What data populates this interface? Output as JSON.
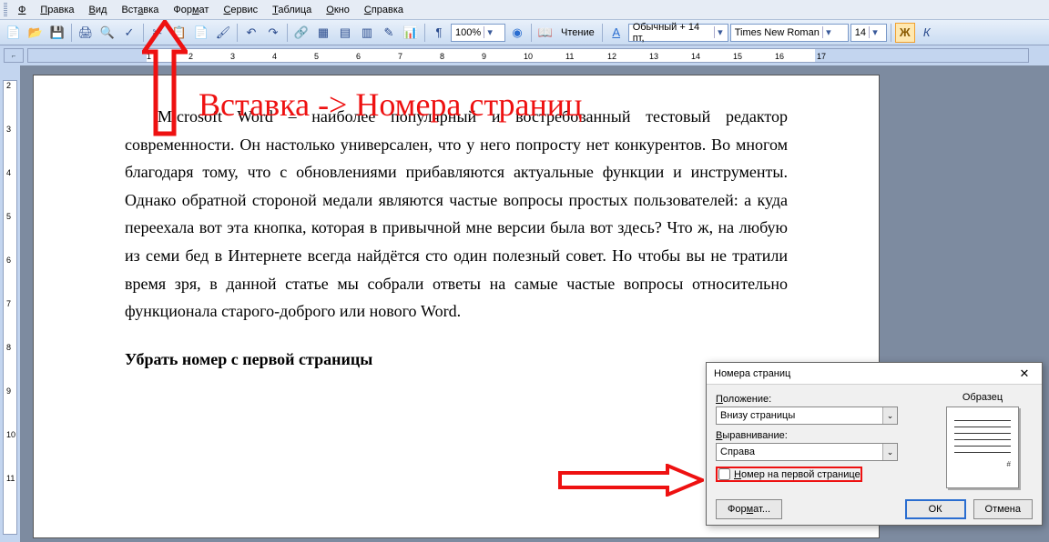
{
  "menu": {
    "file": "Файл",
    "edit": "Правка",
    "view": "Вид",
    "insert": "Вставка",
    "format": "Формат",
    "service": "Сервис",
    "table": "Таблица",
    "window": "Окно",
    "help": "Справка"
  },
  "toolbar": {
    "zoom": "100%",
    "reading": "Чтение",
    "style": "Обычный + 14 пт,",
    "font": "Times New Roman",
    "size": "14"
  },
  "annotation": {
    "text": "Вставка -> Номера страниц"
  },
  "document": {
    "para1": "Microsoft Word – наиболее популярный и востребованный тестовый редактор современности. Он настолько универсален, что у него попросту нет конкурентов. Во многом благодаря тому, что с обновлениями прибавляются актуальные функции и инструменты. Однако обратной стороной медали являются частые вопросы простых пользователей: а куда переехала вот эта кнопка, которая в привычной мне версии была вот здесь? Что ж, на любую из семи бед в Интернете всегда найдётся сто один полезный совет. Но чтобы вы не тратили время зря, в данной статье мы собрали ответы на самые частые вопросы относительно функционала старого-доброго или нового Word.",
    "heading": "Убрать номер с первой страницы"
  },
  "dialog": {
    "title": "Номера страниц",
    "position_label": "Положение:",
    "position_value": "Внизу страницы",
    "align_label": "Выравнивание:",
    "align_value": "Справа",
    "checkbox": "Номер на первой странице",
    "sample": "Образец",
    "format_btn": "Формат...",
    "ok": "ОК",
    "cancel": "Отмена"
  },
  "ruler": {
    "ticks": [
      "1",
      "2",
      "3",
      "4",
      "5",
      "6",
      "7",
      "8",
      "9",
      "10",
      "11",
      "12",
      "13",
      "14",
      "15",
      "16",
      "17"
    ]
  }
}
